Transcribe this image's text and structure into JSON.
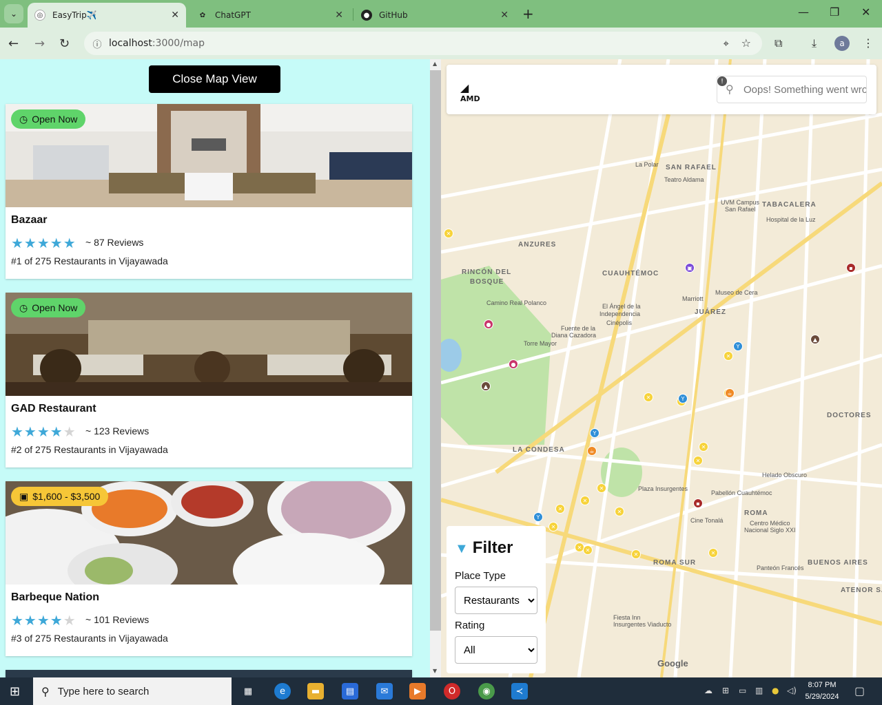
{
  "browser": {
    "tabs": [
      {
        "title": "EasyTrip✈️",
        "active": true
      },
      {
        "title": "ChatGPT",
        "active": false
      },
      {
        "title": "GitHub",
        "active": false
      }
    ],
    "url_host": "localhost",
    "url_path": ":3000/map",
    "profile_initial": "a"
  },
  "page": {
    "close_map_label": "Close Map View",
    "cards": [
      {
        "badge": "Open Now",
        "badge_type": "open",
        "name": "Bazaar",
        "rating": 5,
        "reviews": "~ 87 Reviews",
        "rank": "#1 of 275 Restaurants in Vijayawada"
      },
      {
        "badge": "Open Now",
        "badge_type": "open",
        "name": "GAD Restaurant",
        "rating": 4,
        "reviews": "~ 123 Reviews",
        "rank": "#2 of 275 Restaurants in Vijayawada"
      },
      {
        "badge": "$1,600 - $3,500",
        "badge_type": "price",
        "name": "Barbeque Nation",
        "rating": 4,
        "reviews": "~ 101 Reviews",
        "rank": "#3 of 275 Restaurants in Vijayawada"
      }
    ]
  },
  "map": {
    "logo": "AMD",
    "search_placeholder": "Oops! Something went wrong",
    "attribution": "Google",
    "filter": {
      "title": "Filter",
      "place_type_label": "Place Type",
      "place_type_value": "Restaurants",
      "rating_label": "Rating",
      "rating_value": "All"
    },
    "labels": {
      "san_rafael": "SAN RAFAEL",
      "teatro": "Teatro Aldama",
      "tabacalera": "TABACALERA",
      "anzures": "ANZURES",
      "rincon": "RINCÓN DEL",
      "bosque": "BOSQUE",
      "cuauhtemoc": "CUAUHTÉMOC",
      "juarez": "JUÁREZ",
      "angel": "El Ángel de la",
      "independencia": "Independencia",
      "cinepolis": "Cinépolis",
      "torre": "Torre Mayor",
      "condesa": "LA CONDESA",
      "doctores": "DOCTORES",
      "roma": "ROMA",
      "roma_sur": "ROMA SUR",
      "buenos_aires": "BUENOS AIRES",
      "camino": "Camino Real Polanco",
      "diana": "Fuente de la",
      "diana2": "Diana Cazadora",
      "plaza": "Plaza Insurgentes",
      "pabellon": "Pabellón Cuauhtémoc",
      "helado": "Helado Obscuro",
      "marriott": "Marriott",
      "museo_cera": "Museo de Cera",
      "uvm": "UVM Campus",
      "uvm2": "San Rafael",
      "hospital": "Hospital de la Luz",
      "cine": "Cine Tonalá",
      "centro": "Centro Médico",
      "centro2": "Nacional Siglo XXI",
      "panteon": "Panteón Francés",
      "la_polar": "La Polar",
      "fiesta": "Fiesta Inn",
      "fiesta2": "Insurgentes Viaducto",
      "atenor": "ATENOR SAL"
    }
  },
  "taskbar": {
    "search_placeholder": "Type here to search",
    "time": "8:07 PM",
    "date": "5/29/2024"
  }
}
